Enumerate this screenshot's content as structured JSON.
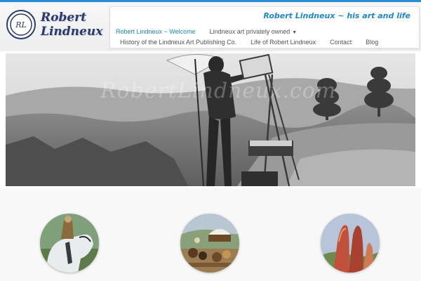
{
  "site": {
    "logo_text_line1": "Robert",
    "logo_text_line2": "Lindneux",
    "logo_seal_letters": "RL",
    "tagline": "Robert Lindneux ~ his art and life",
    "accent_color": "#1e88c8"
  },
  "nav": {
    "row1": [
      {
        "label": "Robert Lindneux ~ Welcome",
        "active": true
      },
      {
        "label": "Lindneux art privately owned",
        "dropdown": true
      }
    ],
    "row2": [
      {
        "label": "History of the Lindneux Art Publishing Co."
      },
      {
        "label": "Life of Robert Lindneux"
      },
      {
        "label": "Contact"
      },
      {
        "label": "Blog"
      }
    ],
    "dropdown_icon": "caret-down-icon"
  },
  "hero": {
    "watermark": "RobertLindneux.com",
    "description_icon": "painter-at-easel-photo"
  },
  "thumbnails": [
    {
      "icon": "horse-rider-painting"
    },
    {
      "icon": "wagon-train-painting"
    },
    {
      "icon": "red-rock-formation-painting"
    }
  ]
}
